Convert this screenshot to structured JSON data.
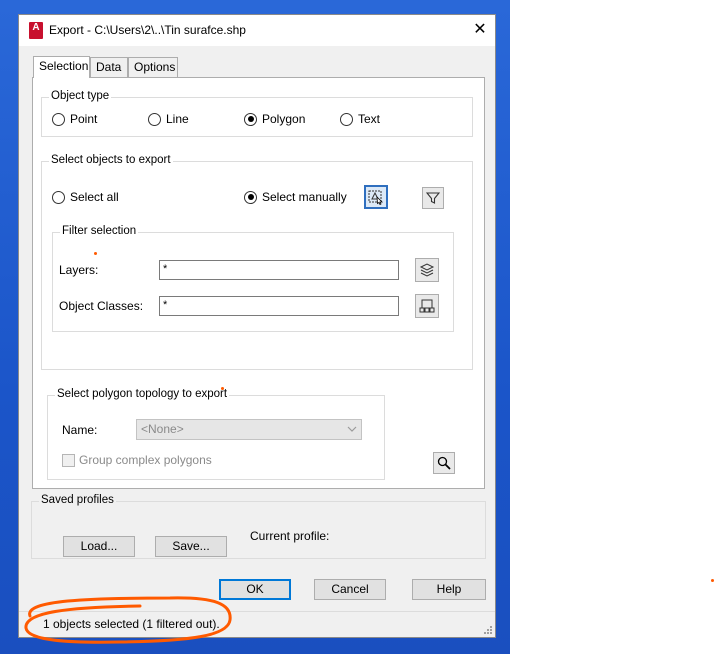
{
  "window": {
    "title": "Export - C:\\Users\\2\\..\\Tin surafce.shp",
    "close_glyph": "✕",
    "app_icon_letter": "A"
  },
  "tabs": [
    {
      "label": "Selection",
      "active": true
    },
    {
      "label": "Data",
      "active": false
    },
    {
      "label": "Options",
      "active": false
    }
  ],
  "object_type": {
    "label": "Object type",
    "options": [
      {
        "label": "Point",
        "checked": false
      },
      {
        "label": "Line",
        "checked": false
      },
      {
        "label": "Polygon",
        "checked": true
      },
      {
        "label": "Text",
        "checked": false
      }
    ]
  },
  "select_objects": {
    "label": "Select objects to export",
    "select_all": "Select all",
    "select_manually": "Select manually",
    "selected_mode": "manually",
    "pick_icon": "select-objects-icon",
    "filter_icon": "filter-icon"
  },
  "filter_selection": {
    "label": "Filter selection",
    "layers_label": "Layers:",
    "layers_value": "*",
    "layers_icon": "layers-icon",
    "object_classes_label": "Object Classes:",
    "object_classes_value": "*",
    "object_classes_icon": "object-classes-icon"
  },
  "polygon_topology": {
    "label": "Select polygon topology to export",
    "name_label": "Name:",
    "name_value": "<None>",
    "group_complex": "Group complex polygons",
    "group_complex_checked": false,
    "zoom_icon": "magnifier-icon"
  },
  "saved_profiles": {
    "label": "Saved profiles",
    "load": "Load...",
    "save": "Save...",
    "current_profile_label": "Current profile:"
  },
  "buttons": {
    "ok": "OK",
    "cancel": "Cancel",
    "help": "Help"
  },
  "status": {
    "text": "1 objects selected (1 filtered out)."
  },
  "colors": {
    "annotation": "#ff5a00",
    "accent": "#0078d7",
    "desktop": "#1b55c9"
  }
}
